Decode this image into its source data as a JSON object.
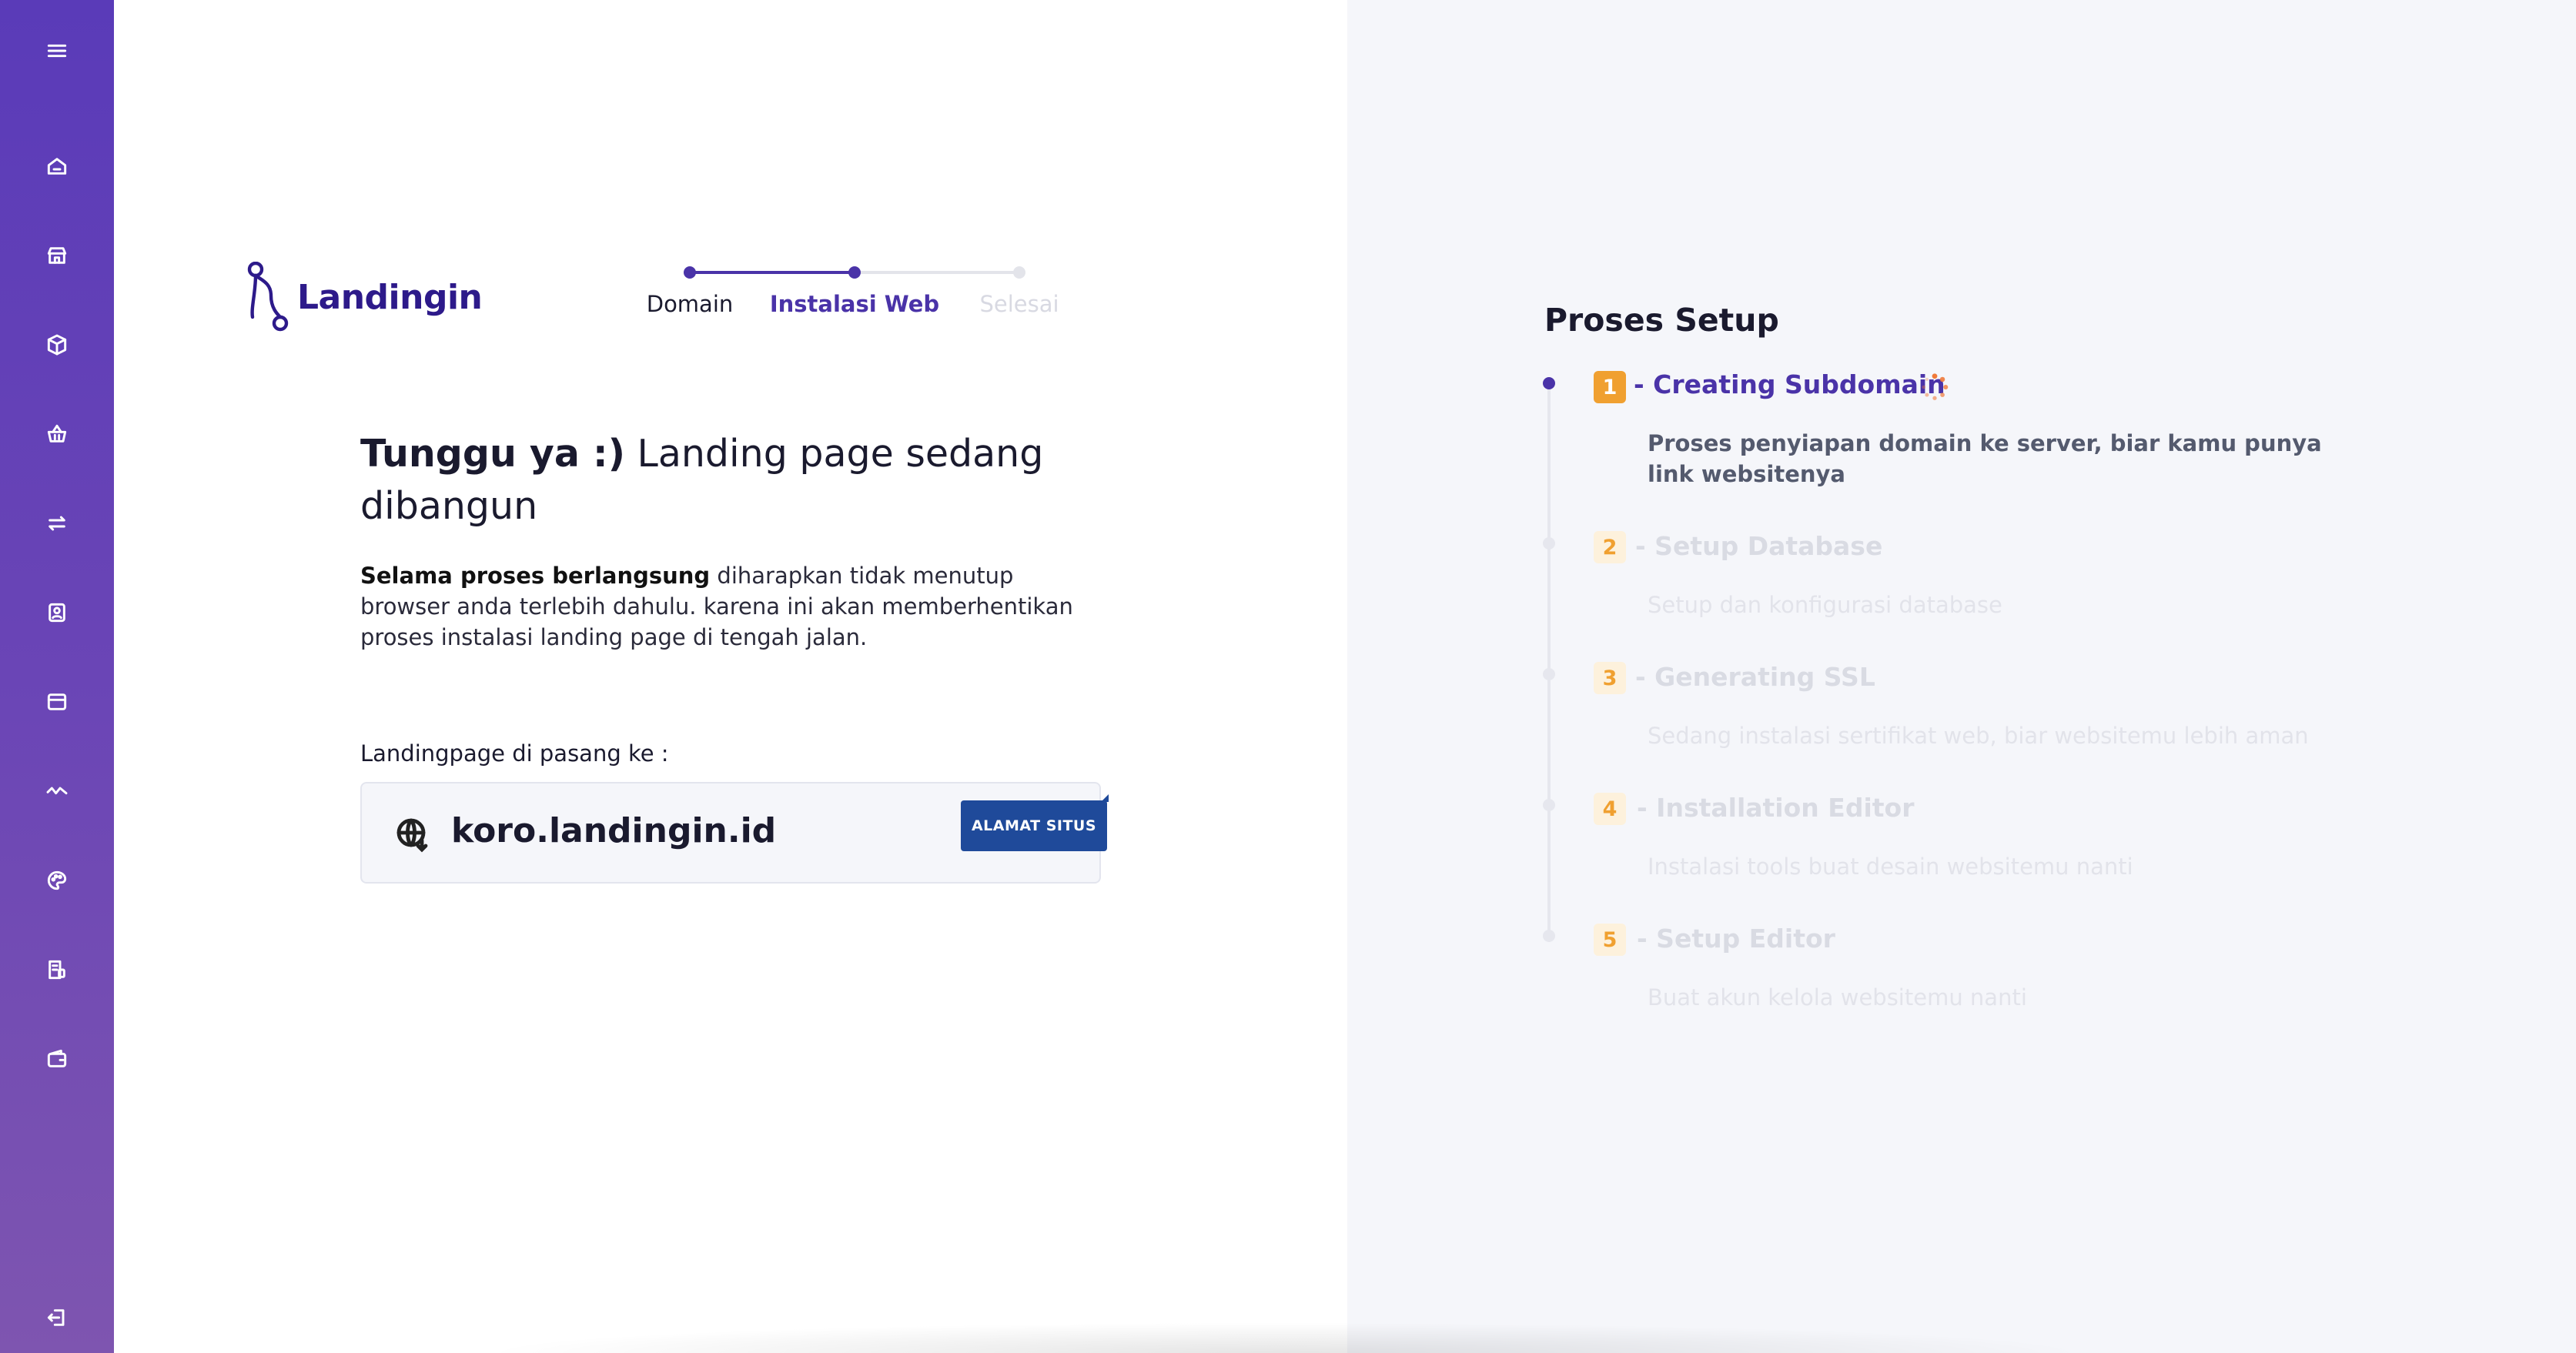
{
  "sidebar": {
    "icons": [
      "menu-icon",
      "home-icon",
      "store-icon",
      "box-icon",
      "basket-icon",
      "transfer-icon",
      "contact-icon",
      "browser-icon",
      "activity-icon",
      "palette-icon",
      "report-icon",
      "wallet-icon",
      "logout-icon"
    ]
  },
  "brand": {
    "name": "Landingin"
  },
  "stepper": {
    "steps": [
      {
        "label": "Domain",
        "state": "done"
      },
      {
        "label": "Instalasi Web",
        "state": "active"
      },
      {
        "label": "Selesai",
        "state": "pending"
      }
    ]
  },
  "main": {
    "heading_bold": "Tunggu ya :)",
    "heading_rest": " Landing page sedang dibangun",
    "desc_bold": "Selama proses berlangsung",
    "desc_rest": " diharapkan tidak menutup browser anda terlebih dahulu. karena ini akan memberhentikan proses instalasi landing page di tengah jalan.",
    "install_label": "Landingpage di pasang ke :",
    "domain": "koro.landingin.id",
    "site_button": "ALAMAT SITUS"
  },
  "process": {
    "title": "Proses Setup",
    "steps": [
      {
        "number": "1",
        "title": "- Creating Subdomain",
        "desc": "Proses penyiapan domain ke server, biar kamu punya link websitenya",
        "state": "active"
      },
      {
        "number": "2",
        "title": "- Setup Database",
        "desc": "Setup dan konfigurasi database",
        "state": "pending"
      },
      {
        "number": "3",
        "title": "- Generating SSL",
        "desc": "Sedang instalasi sertifikat web, biar websitemu lebih aman",
        "state": "pending"
      },
      {
        "number": "4",
        "title": "- Installation Editor",
        "desc": "Instalasi tools buat desain websitemu nanti",
        "state": "pending"
      },
      {
        "number": "5",
        "title": "- Setup Editor",
        "desc": "Buat akun kelola websitemu nanti",
        "state": "pending"
      }
    ]
  },
  "colors": {
    "sidebar": "#5a3bb8",
    "brand": "#2d1a8a",
    "accent": "#4a33a8",
    "button": "#1f4a9a",
    "badge_active": "#f0a030",
    "badge_pending_bg": "#fdf1dc",
    "spinner": "#f07a3a"
  }
}
